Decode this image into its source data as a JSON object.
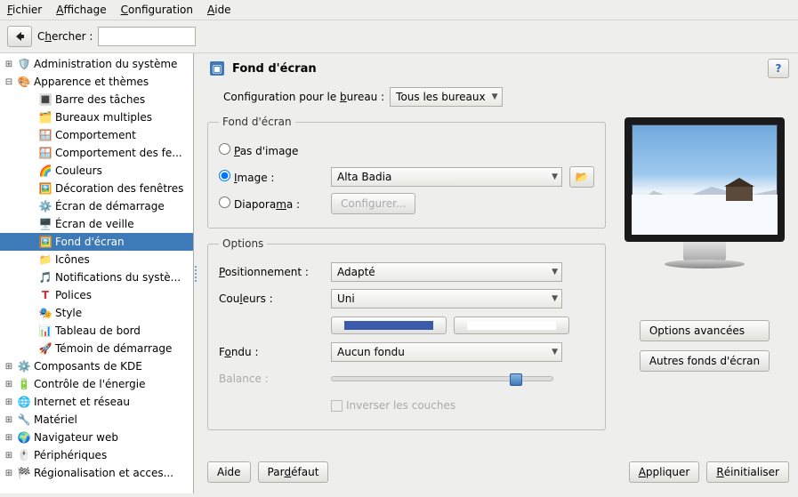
{
  "menubar": {
    "file": "Fichier",
    "view": "Affichage",
    "config": "Configuration",
    "help": "Aide"
  },
  "toolbar": {
    "search_label": "Chercher :"
  },
  "tree": {
    "admin": "Administration du système",
    "appearance": "Apparence et thèmes",
    "children": {
      "taskbar": "Barre des tâches",
      "desks": "Bureaux multiples",
      "behavior": "Comportement",
      "winbehavior": "Comportement des fe...",
      "colors": "Couleurs",
      "windeco": "Décoration des fenêtres",
      "splash": "Écran de démarrage",
      "screensaver": "Écran de veille",
      "wallpaper": "Fond d'écran",
      "icons": "Icônes",
      "notif": "Notifications du systè...",
      "fonts": "Polices",
      "style": "Style",
      "panel": "Tableau de bord",
      "launch": "Témoin de démarrage"
    },
    "kde": "Composants de KDE",
    "power": "Contrôle de l'énergie",
    "net": "Internet et réseau",
    "hw": "Matériel",
    "browser": "Navigateur web",
    "periph": "Périphériques",
    "region": "Régionalisation et acces..."
  },
  "header": {
    "title": "Fond d'écran"
  },
  "config": {
    "desktop_for_label": "Configuration pour le bureau :",
    "desktop_value": "Tous les bureaux",
    "group_wallpaper": "Fond d'écran",
    "no_image": "Pas d'image",
    "image": "Image :",
    "image_value": "Alta Badia",
    "diaporama": "Diaporama :",
    "configure_btn": "Configurer...",
    "group_options": "Options",
    "position": "Positionnement :",
    "position_value": "Adapté",
    "colors_label": "Couleurs :",
    "colors_value": "Uni",
    "blend": "Fondu :",
    "blend_value": "Aucun fondu",
    "balance": "Balance :",
    "invert": "Inverser les couches",
    "color1": "#3b5aa9",
    "color2": "#ffffff"
  },
  "side": {
    "advanced": "Options avancées",
    "other": "Autres fonds d'écran"
  },
  "footer": {
    "help": "Aide",
    "defaults": "Par défaut",
    "apply": "Appliquer",
    "reset": "Réinitialiser"
  }
}
